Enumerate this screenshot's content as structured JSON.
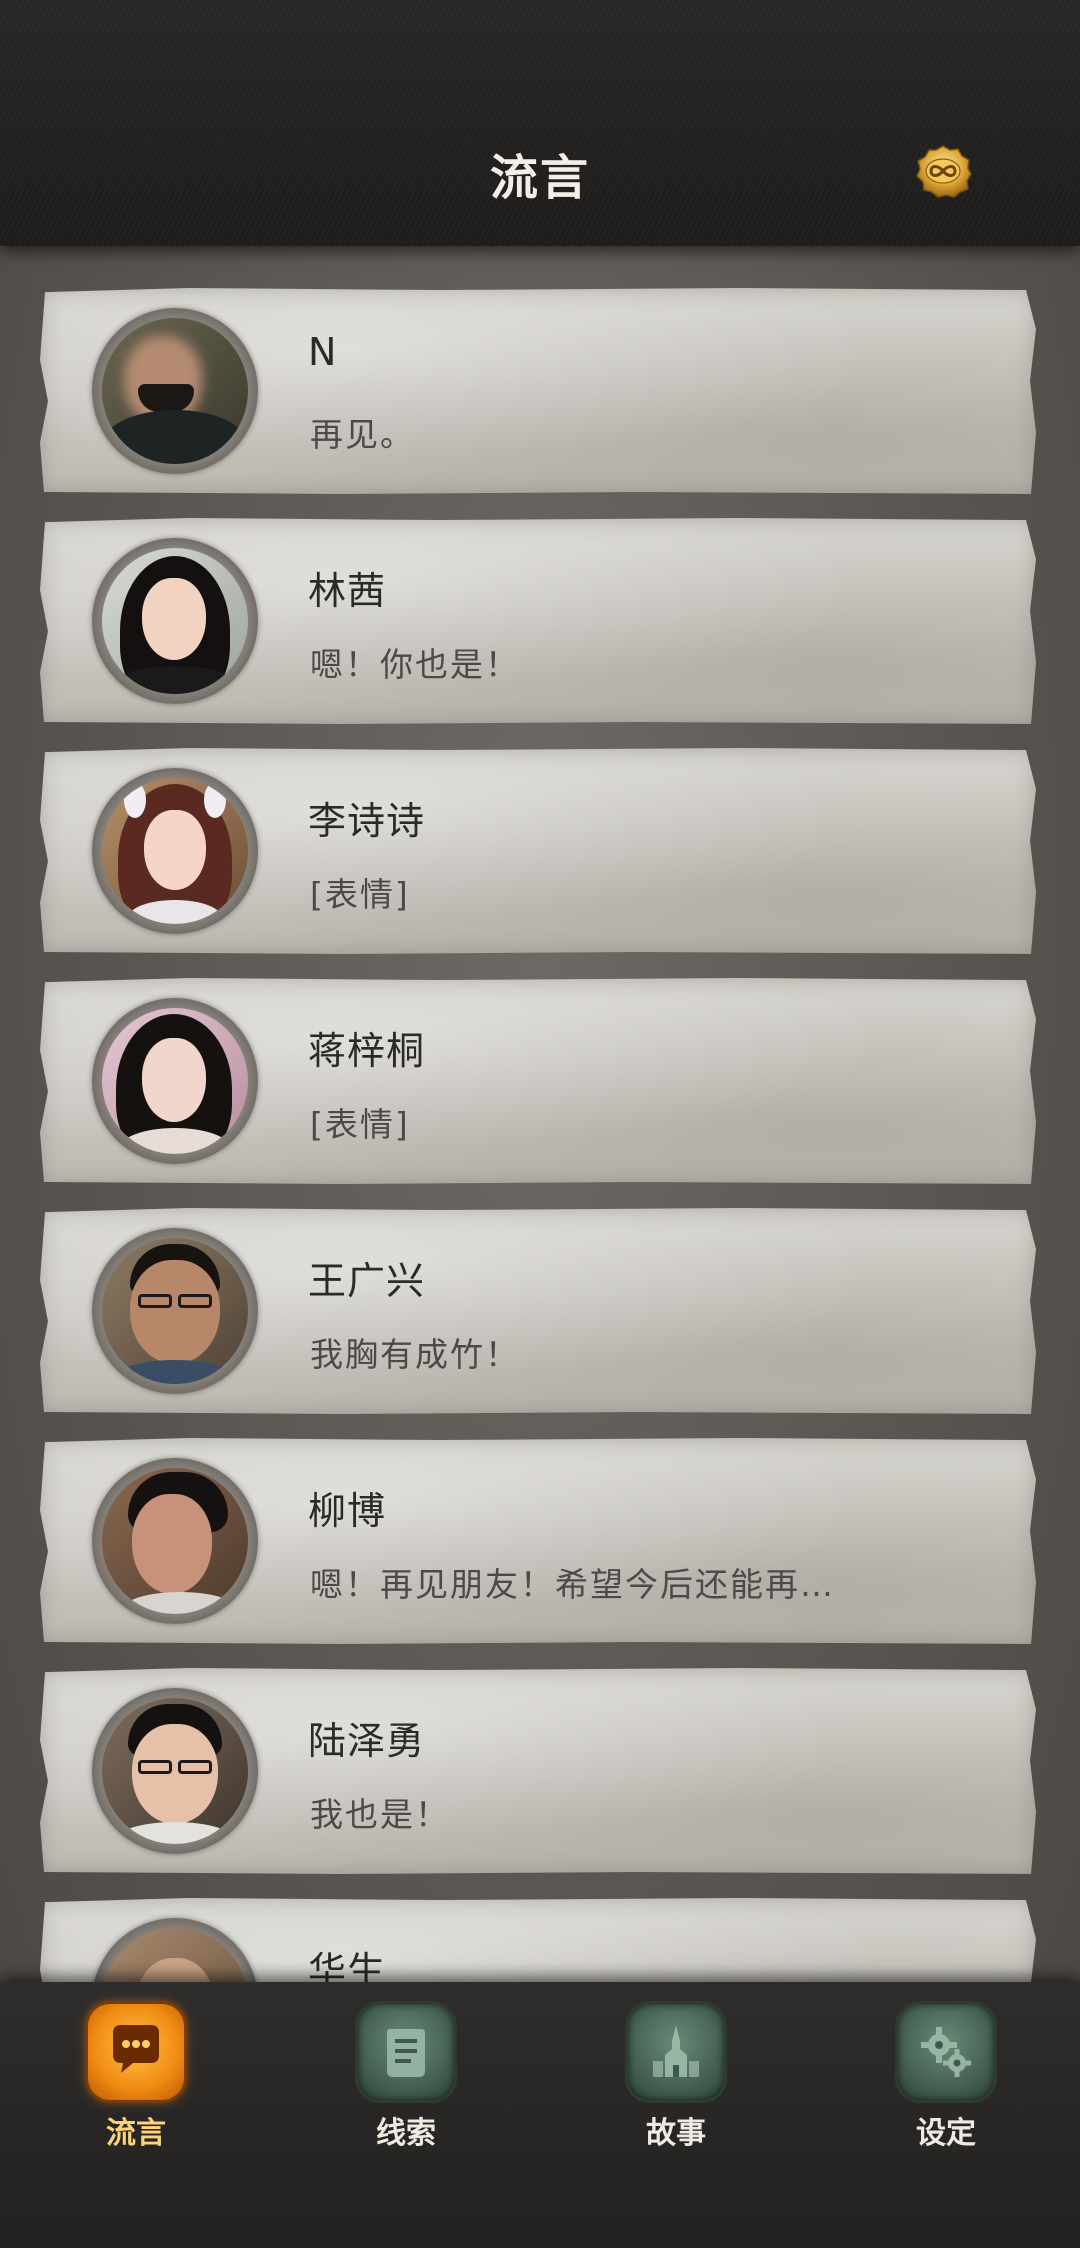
{
  "header": {
    "title": "流言",
    "badge_icon": "infinity-coin-icon"
  },
  "contacts": [
    {
      "name": "N",
      "message": "再见。",
      "avatar": {
        "skin": "#b58b72",
        "hair": "#1a1715",
        "body": "#1e2424",
        "bg": "#4d4a3d",
        "glasses": false,
        "face_hidden": true
      }
    },
    {
      "name": "林茜",
      "message": "嗯！你也是！",
      "avatar": {
        "skin": "#f2d2c0",
        "hair": "#141010",
        "body": "#1a1a1a",
        "bg": "#c7c9c4",
        "glasses": false
      }
    },
    {
      "name": "李诗诗",
      "message": "[表情]",
      "avatar": {
        "skin": "#f4d5c8",
        "hair": "#5a2a22",
        "body": "#e9e6ea",
        "bg": "#a07b59",
        "glasses": false
      }
    },
    {
      "name": "蒋梓桐",
      "message": "[表情]",
      "avatar": {
        "skin": "#f3d6cb",
        "hair": "#15110f",
        "body": "#e7ddd6",
        "bg": "#d6b8c4",
        "glasses": false
      }
    },
    {
      "name": "王广兴",
      "message": "我胸有成竹！",
      "avatar": {
        "skin": "#b8876a",
        "hair": "#171310",
        "body": "#3a4c66",
        "bg": "#7b6a55",
        "glasses": true
      }
    },
    {
      "name": "柳博",
      "message": "嗯！再见朋友！希望今后还能再…",
      "avatar": {
        "skin": "#c8927a",
        "hair": "#141110",
        "body": "#d8d4cf",
        "bg": "#7a5a44",
        "glasses": false
      }
    },
    {
      "name": "陆泽勇",
      "message": "我也是！",
      "avatar": {
        "skin": "#e6c0a8",
        "hair": "#141110",
        "body": "#e4e2df",
        "bg": "#6e5e50",
        "glasses": true
      }
    },
    {
      "name": "华生",
      "message": "",
      "avatar": {
        "skin": "#c9a385",
        "hair": "#5a4030",
        "body": "#7a6350",
        "bg": "#8a6f58",
        "glasses": false
      }
    }
  ],
  "nav": {
    "items": [
      {
        "label": "流言",
        "icon": "chat-bubble-icon",
        "active": true
      },
      {
        "label": "线索",
        "icon": "scroll-icon",
        "active": false
      },
      {
        "label": "故事",
        "icon": "tower-icon",
        "active": false
      },
      {
        "label": "设定",
        "icon": "gear-icon",
        "active": false
      }
    ]
  },
  "colors": {
    "accent": "#f08a12",
    "nav_inactive": "#4f6d5c",
    "card": "#cfcdc7",
    "header_bg": "#232120"
  }
}
